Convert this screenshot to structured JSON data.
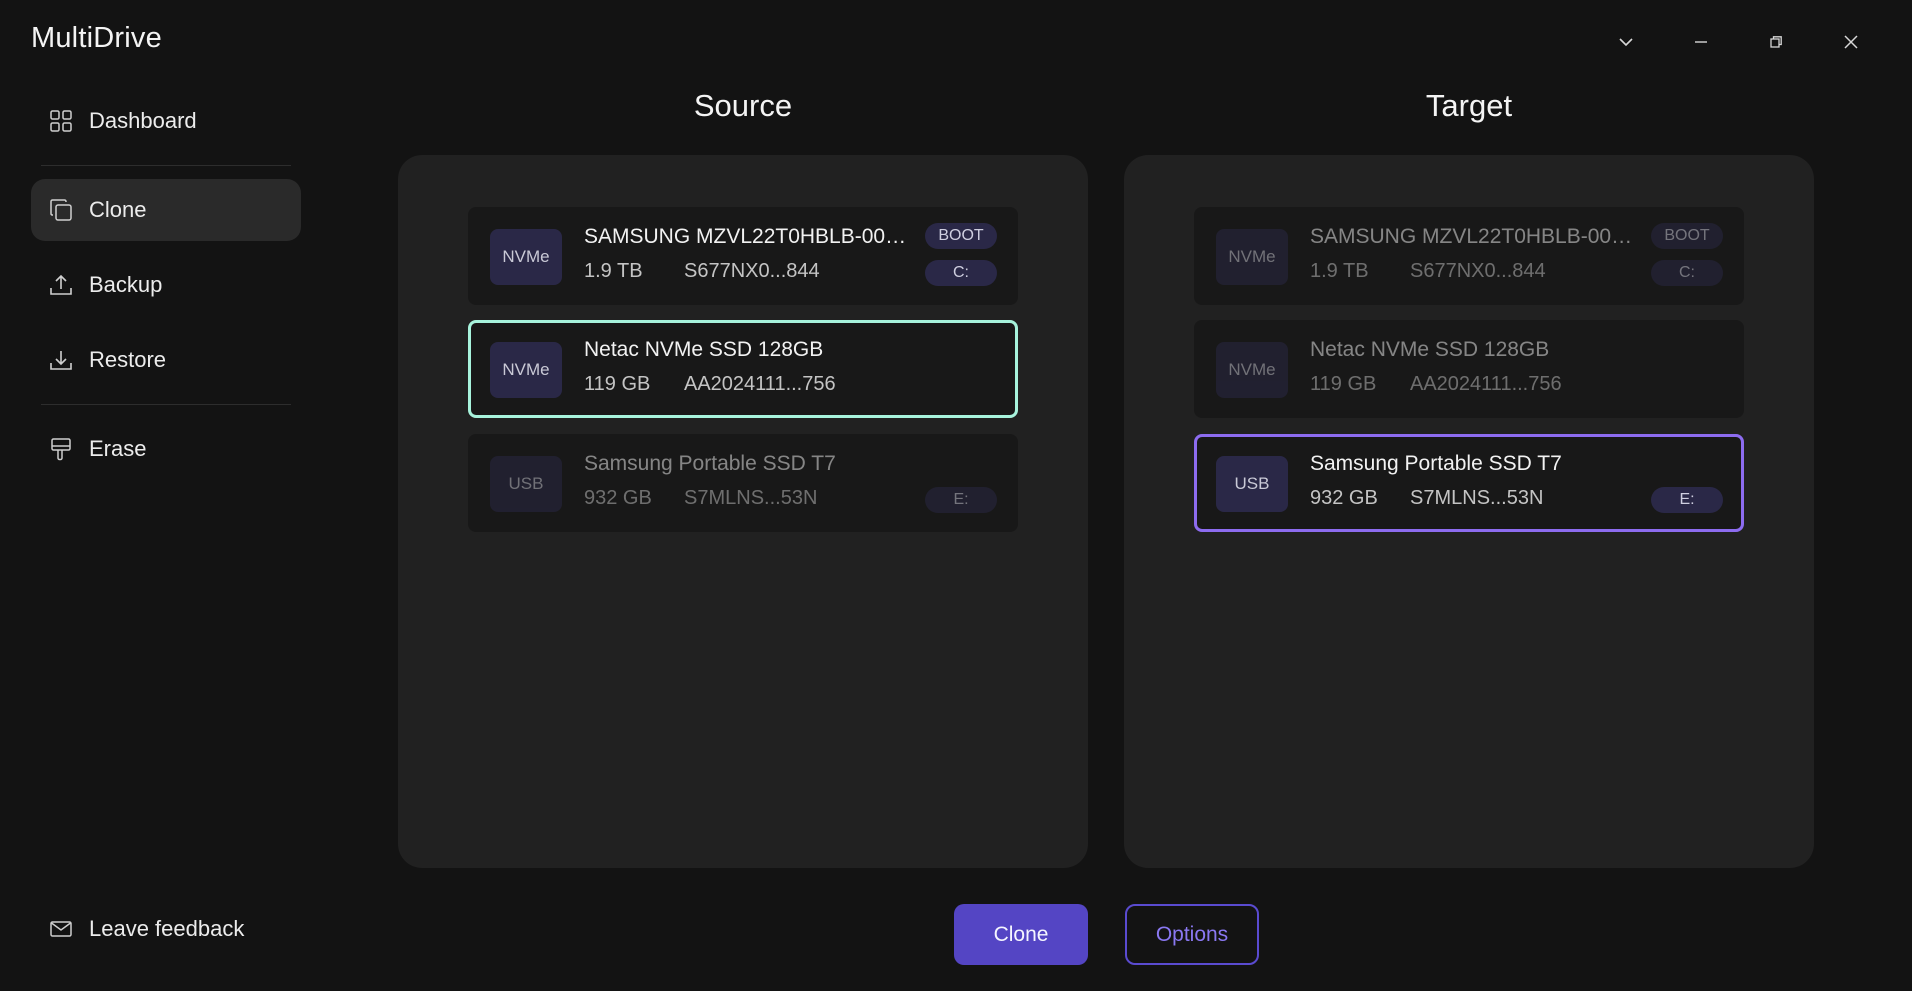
{
  "app": {
    "title": "MultiDrive"
  },
  "window": {
    "controls": [
      "chevron-down",
      "minimize",
      "restore",
      "close"
    ]
  },
  "sidebar": {
    "items": [
      {
        "label": "Dashboard",
        "icon": "grid-icon",
        "active": false
      },
      {
        "label": "Clone",
        "icon": "copy-icon",
        "active": true
      },
      {
        "label": "Backup",
        "icon": "upload-icon",
        "active": false
      },
      {
        "label": "Restore",
        "icon": "download-icon",
        "active": false
      },
      {
        "label": "Erase",
        "icon": "eraser-icon",
        "active": false
      }
    ],
    "feedback": {
      "label": "Leave feedback",
      "icon": "mail-icon"
    }
  },
  "source": {
    "title": "Source",
    "drives": [
      {
        "type": "NVMe",
        "name": "SAMSUNG MZVL22T0HBLB-00B...",
        "size": "1.9 TB",
        "serial": "S677NX0...844",
        "tags": [
          "BOOT",
          "C:"
        ],
        "state": "normal"
      },
      {
        "type": "NVMe",
        "name": "Netac NVMe SSD 128GB",
        "size": "119 GB",
        "serial": "AA2024111...756",
        "tags": [],
        "state": "selected"
      },
      {
        "type": "USB",
        "name": "Samsung Portable SSD T7",
        "size": "932 GB",
        "serial": "S7MLNS...53N",
        "tags": [
          "E:"
        ],
        "state": "disabled"
      }
    ]
  },
  "target": {
    "title": "Target",
    "drives": [
      {
        "type": "NVMe",
        "name": "SAMSUNG MZVL22T0HBLB-00B...",
        "size": "1.9 TB",
        "serial": "S677NX0...844",
        "tags": [
          "BOOT",
          "C:"
        ],
        "state": "disabled"
      },
      {
        "type": "NVMe",
        "name": "Netac NVMe SSD 128GB",
        "size": "119 GB",
        "serial": "AA2024111...756",
        "tags": [],
        "state": "disabled"
      },
      {
        "type": "USB",
        "name": "Samsung Portable SSD T7",
        "size": "932 GB",
        "serial": "S7MLNS...53N",
        "tags": [
          "E:"
        ],
        "state": "selected"
      }
    ]
  },
  "actions": {
    "clone_label": "Clone",
    "options_label": "Options"
  },
  "colors": {
    "background": "#131313",
    "panel": "#212121",
    "card": "#181818",
    "badge": "#2a2847",
    "source_selected": "#a7f3dc",
    "target_selected": "#8d6cf0",
    "primary": "#5445c4"
  }
}
